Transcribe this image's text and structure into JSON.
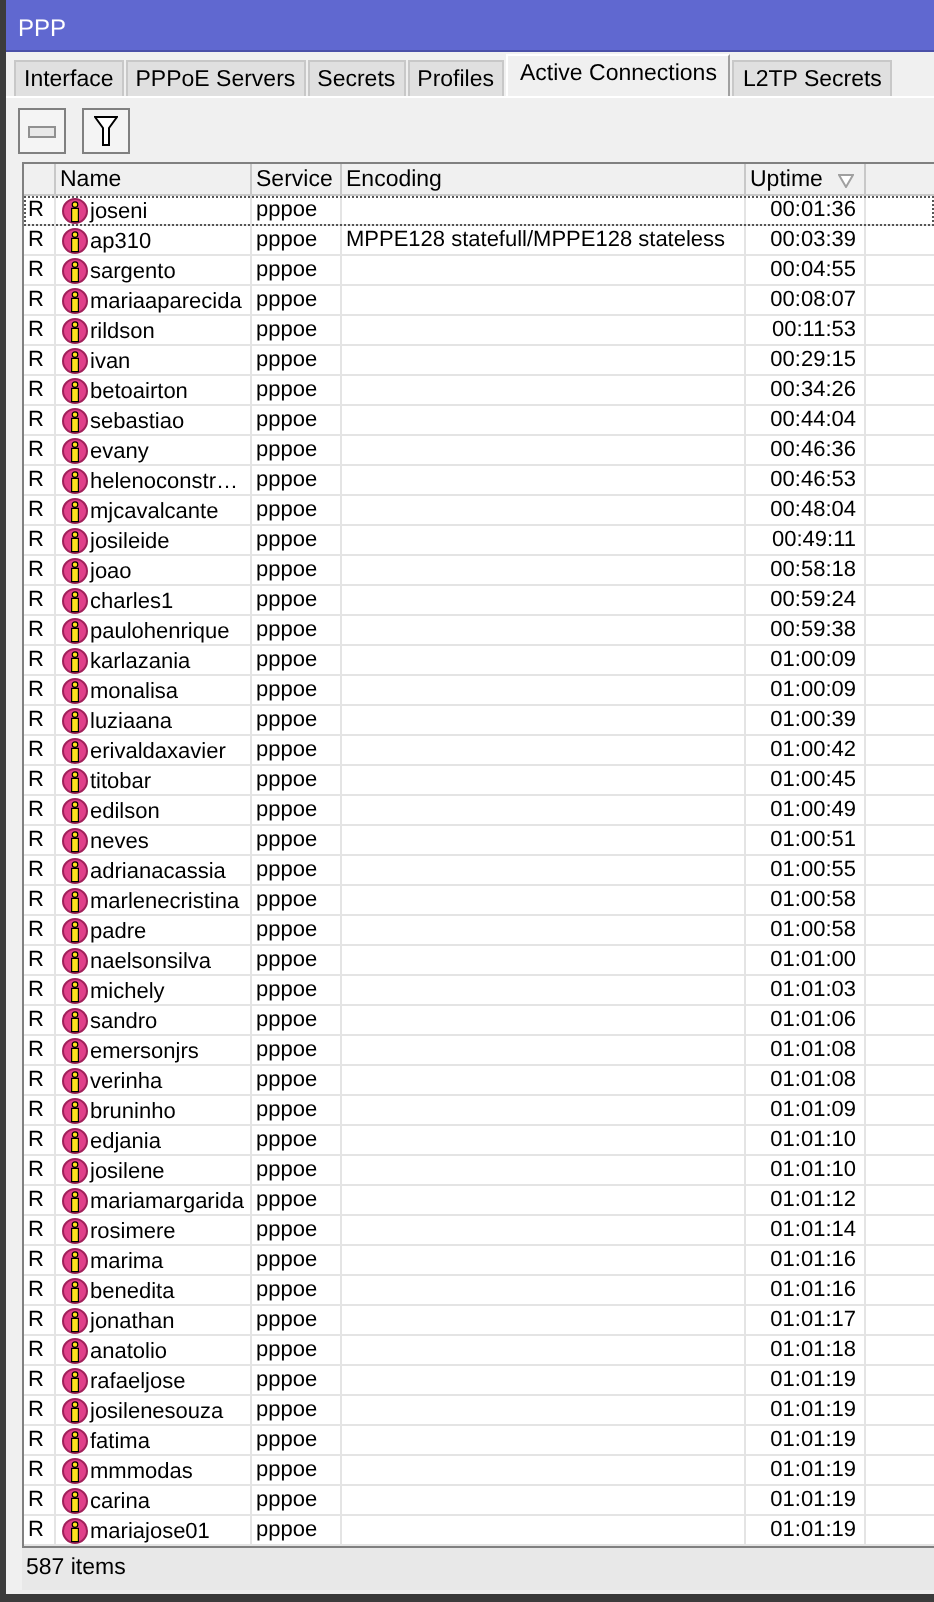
{
  "window": {
    "title": "PPP"
  },
  "tabs": [
    {
      "label": "Interface",
      "selected": false
    },
    {
      "label": "PPPoE Servers",
      "selected": false
    },
    {
      "label": "Secrets",
      "selected": false
    },
    {
      "label": "Profiles",
      "selected": false
    },
    {
      "label": "Active Connections",
      "selected": true
    },
    {
      "label": "L2TP Secrets",
      "selected": false
    }
  ],
  "table": {
    "columns": [
      {},
      {
        "label": "Name",
        "sorted": false
      },
      {
        "label": "Service",
        "sorted": false
      },
      {
        "label": "Encoding",
        "sorted": false
      },
      {
        "label": "Uptime",
        "sorted": true
      },
      {}
    ],
    "rows": [
      {
        "flag": "R",
        "name": "joseni",
        "service": "pppoe",
        "encoding": "",
        "uptime": "00:01:36",
        "focused": true
      },
      {
        "flag": "R",
        "name": "ap310",
        "service": "pppoe",
        "encoding": "MPPE128 statefull/MPPE128 stateless",
        "uptime": "00:03:39",
        "focused": false
      },
      {
        "flag": "R",
        "name": "sargento",
        "service": "pppoe",
        "encoding": "",
        "uptime": "00:04:55",
        "focused": false
      },
      {
        "flag": "R",
        "name": "mariaaparecida",
        "service": "pppoe",
        "encoding": "",
        "uptime": "00:08:07",
        "focused": false
      },
      {
        "flag": "R",
        "name": "rildson",
        "service": "pppoe",
        "encoding": "",
        "uptime": "00:11:53",
        "focused": false
      },
      {
        "flag": "R",
        "name": "ivan",
        "service": "pppoe",
        "encoding": "",
        "uptime": "00:29:15",
        "focused": false
      },
      {
        "flag": "R",
        "name": "betoairton",
        "service": "pppoe",
        "encoding": "",
        "uptime": "00:34:26",
        "focused": false
      },
      {
        "flag": "R",
        "name": "sebastiao",
        "service": "pppoe",
        "encoding": "",
        "uptime": "00:44:04",
        "focused": false
      },
      {
        "flag": "R",
        "name": "evany",
        "service": "pppoe",
        "encoding": "",
        "uptime": "00:46:36",
        "focused": false
      },
      {
        "flag": "R",
        "name": "helenoconstr…",
        "service": "pppoe",
        "encoding": "",
        "uptime": "00:46:53",
        "focused": false
      },
      {
        "flag": "R",
        "name": "mjcavalcante",
        "service": "pppoe",
        "encoding": "",
        "uptime": "00:48:04",
        "focused": false
      },
      {
        "flag": "R",
        "name": "josileide",
        "service": "pppoe",
        "encoding": "",
        "uptime": "00:49:11",
        "focused": false
      },
      {
        "flag": "R",
        "name": "joao",
        "service": "pppoe",
        "encoding": "",
        "uptime": "00:58:18",
        "focused": false
      },
      {
        "flag": "R",
        "name": "charles1",
        "service": "pppoe",
        "encoding": "",
        "uptime": "00:59:24",
        "focused": false
      },
      {
        "flag": "R",
        "name": "paulohenrique",
        "service": "pppoe",
        "encoding": "",
        "uptime": "00:59:38",
        "focused": false
      },
      {
        "flag": "R",
        "name": "karlazania",
        "service": "pppoe",
        "encoding": "",
        "uptime": "01:00:09",
        "focused": false
      },
      {
        "flag": "R",
        "name": "monalisa",
        "service": "pppoe",
        "encoding": "",
        "uptime": "01:00:09",
        "focused": false
      },
      {
        "flag": "R",
        "name": "luziaana",
        "service": "pppoe",
        "encoding": "",
        "uptime": "01:00:39",
        "focused": false
      },
      {
        "flag": "R",
        "name": "erivaldaxavier",
        "service": "pppoe",
        "encoding": "",
        "uptime": "01:00:42",
        "focused": false
      },
      {
        "flag": "R",
        "name": "titobar",
        "service": "pppoe",
        "encoding": "",
        "uptime": "01:00:45",
        "focused": false
      },
      {
        "flag": "R",
        "name": "edilson",
        "service": "pppoe",
        "encoding": "",
        "uptime": "01:00:49",
        "focused": false
      },
      {
        "flag": "R",
        "name": "neves",
        "service": "pppoe",
        "encoding": "",
        "uptime": "01:00:51",
        "focused": false
      },
      {
        "flag": "R",
        "name": "adrianacassia",
        "service": "pppoe",
        "encoding": "",
        "uptime": "01:00:55",
        "focused": false
      },
      {
        "flag": "R",
        "name": "marlenecristina",
        "service": "pppoe",
        "encoding": "",
        "uptime": "01:00:58",
        "focused": false
      },
      {
        "flag": "R",
        "name": "padre",
        "service": "pppoe",
        "encoding": "",
        "uptime": "01:00:58",
        "focused": false
      },
      {
        "flag": "R",
        "name": "naelsonsilva",
        "service": "pppoe",
        "encoding": "",
        "uptime": "01:01:00",
        "focused": false
      },
      {
        "flag": "R",
        "name": "michely",
        "service": "pppoe",
        "encoding": "",
        "uptime": "01:01:03",
        "focused": false
      },
      {
        "flag": "R",
        "name": "sandro",
        "service": "pppoe",
        "encoding": "",
        "uptime": "01:01:06",
        "focused": false
      },
      {
        "flag": "R",
        "name": "emersonjrs",
        "service": "pppoe",
        "encoding": "",
        "uptime": "01:01:08",
        "focused": false
      },
      {
        "flag": "R",
        "name": "verinha",
        "service": "pppoe",
        "encoding": "",
        "uptime": "01:01:08",
        "focused": false
      },
      {
        "flag": "R",
        "name": "bruninho",
        "service": "pppoe",
        "encoding": "",
        "uptime": "01:01:09",
        "focused": false
      },
      {
        "flag": "R",
        "name": "edjania",
        "service": "pppoe",
        "encoding": "",
        "uptime": "01:01:10",
        "focused": false
      },
      {
        "flag": "R",
        "name": "josilene",
        "service": "pppoe",
        "encoding": "",
        "uptime": "01:01:10",
        "focused": false
      },
      {
        "flag": "R",
        "name": "mariamargarida",
        "service": "pppoe",
        "encoding": "",
        "uptime": "01:01:12",
        "focused": false
      },
      {
        "flag": "R",
        "name": "rosimere",
        "service": "pppoe",
        "encoding": "",
        "uptime": "01:01:14",
        "focused": false
      },
      {
        "flag": "R",
        "name": "marima",
        "service": "pppoe",
        "encoding": "",
        "uptime": "01:01:16",
        "focused": false
      },
      {
        "flag": "R",
        "name": "benedita",
        "service": "pppoe",
        "encoding": "",
        "uptime": "01:01:16",
        "focused": false
      },
      {
        "flag": "R",
        "name": "jonathan",
        "service": "pppoe",
        "encoding": "",
        "uptime": "01:01:17",
        "focused": false
      },
      {
        "flag": "R",
        "name": "anatolio",
        "service": "pppoe",
        "encoding": "",
        "uptime": "01:01:18",
        "focused": false
      },
      {
        "flag": "R",
        "name": "rafaeljose",
        "service": "pppoe",
        "encoding": "",
        "uptime": "01:01:19",
        "focused": false
      },
      {
        "flag": "R",
        "name": "josilenesouza",
        "service": "pppoe",
        "encoding": "",
        "uptime": "01:01:19",
        "focused": false
      },
      {
        "flag": "R",
        "name": "fatima",
        "service": "pppoe",
        "encoding": "",
        "uptime": "01:01:19",
        "focused": false
      },
      {
        "flag": "R",
        "name": "mmmodas",
        "service": "pppoe",
        "encoding": "",
        "uptime": "01:01:19",
        "focused": false
      },
      {
        "flag": "R",
        "name": "carina",
        "service": "pppoe",
        "encoding": "",
        "uptime": "01:01:19",
        "focused": false
      },
      {
        "flag": "R",
        "name": "mariajose01",
        "service": "pppoe",
        "encoding": "",
        "uptime": "01:01:19",
        "focused": false
      }
    ]
  },
  "status_bar": {
    "text": "587 items"
  }
}
